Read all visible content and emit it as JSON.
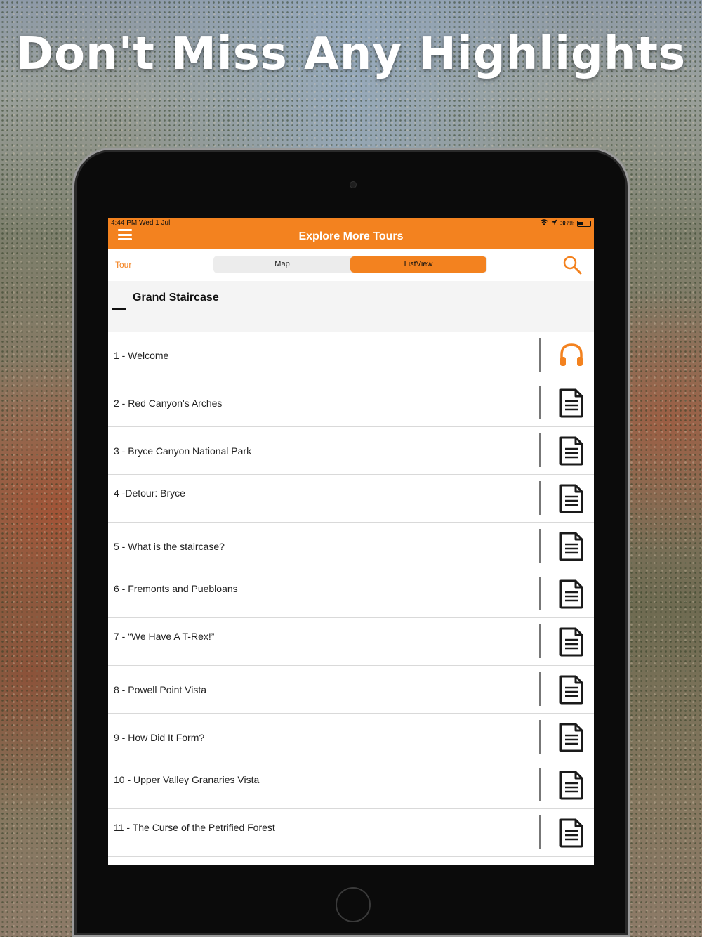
{
  "headline": "Don't Miss Any Highlights",
  "status_bar": {
    "time": "4:44 PM   Wed 1 Jul",
    "battery": "38%",
    "battery_level": 0.38
  },
  "header": {
    "title": "Explore More Tours"
  },
  "toolbar": {
    "tour_label": "Tour",
    "segments": [
      "Map",
      "ListView"
    ],
    "selected_segment": "ListView"
  },
  "section": {
    "title": "Grand Staircase"
  },
  "colors": {
    "accent": "#f3821f"
  },
  "items": [
    {
      "label": "1 - Welcome",
      "icon": "headphones-icon"
    },
    {
      "label": "2 - Red Canyon's Arches",
      "icon": "document-icon"
    },
    {
      "label": "3 - Bryce Canyon National Park",
      "icon": "document-icon"
    },
    {
      "label": "4 -Detour: Bryce",
      "icon": "document-icon"
    },
    {
      "label": "5 - What is the staircase?",
      "icon": "document-icon"
    },
    {
      "label": "6 - Fremonts and Puebloans",
      "icon": "document-icon"
    },
    {
      "label": "7 - “We Have A T-Rex!”",
      "icon": "document-icon"
    },
    {
      "label": "8 - Powell Point Vista",
      "icon": "document-icon"
    },
    {
      "label": "9 - How Did It Form?",
      "icon": "document-icon"
    },
    {
      "label": "10 - Upper Valley Granaries Vista",
      "icon": "document-icon"
    },
    {
      "label": "11 - The Curse of the Petrified Forest",
      "icon": "document-icon"
    }
  ]
}
